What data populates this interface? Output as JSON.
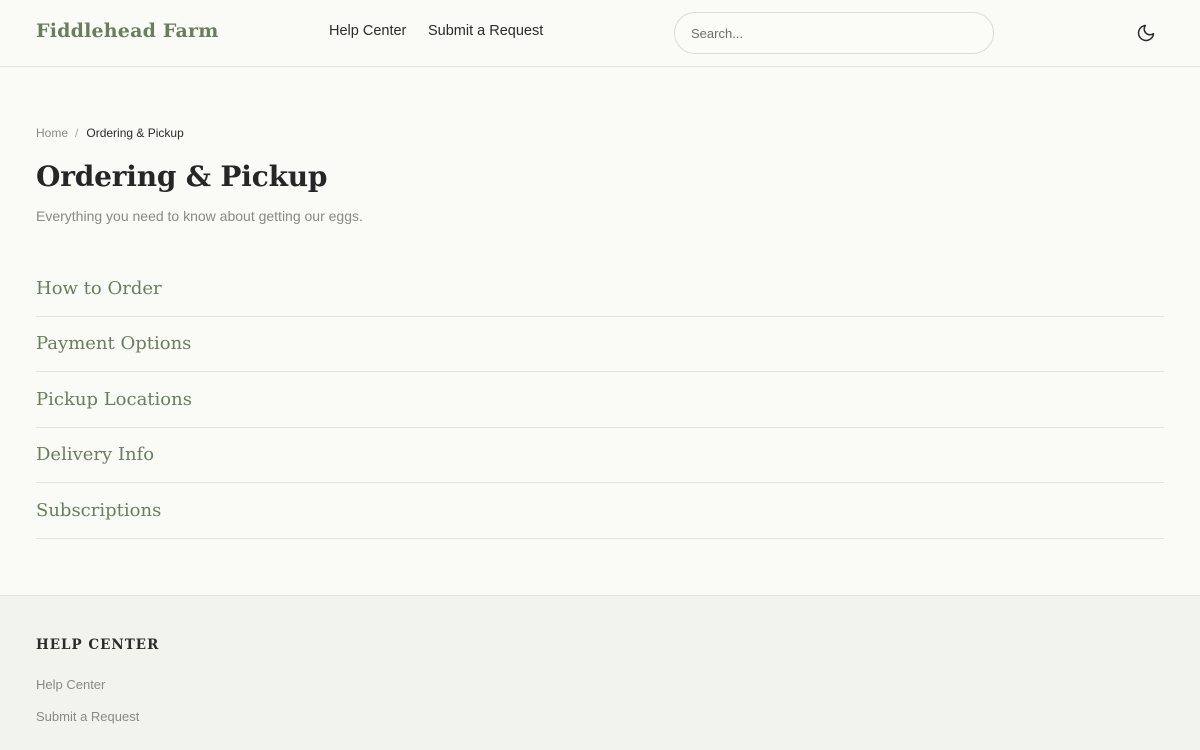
{
  "header": {
    "brand": "Fiddlehead Farm",
    "nav": {
      "help_center": "Help Center",
      "submit_request": "Submit a Request"
    },
    "search": {
      "placeholder": "Search...",
      "value": ""
    },
    "theme_toggle_icon": "moon-icon"
  },
  "breadcrumb": {
    "home": "Home",
    "separator": "/",
    "current": "Ordering & Pickup"
  },
  "page": {
    "title": "Ordering & Pickup",
    "subtitle": "Everything you need to know about getting our eggs."
  },
  "sections": [
    {
      "label": "How to Order"
    },
    {
      "label": "Payment Options"
    },
    {
      "label": "Pickup Locations"
    },
    {
      "label": "Delivery Info"
    },
    {
      "label": "Subscriptions"
    }
  ],
  "footer": {
    "heading": "HELP CENTER",
    "links": {
      "help_center": "Help Center",
      "submit_request": "Submit a Request"
    }
  },
  "colors": {
    "accent": "#6b7d5e",
    "background": "#fafaf6",
    "footer_background": "#f3f3ee",
    "muted_text": "#8a8a84",
    "border": "#e4e4dc"
  }
}
